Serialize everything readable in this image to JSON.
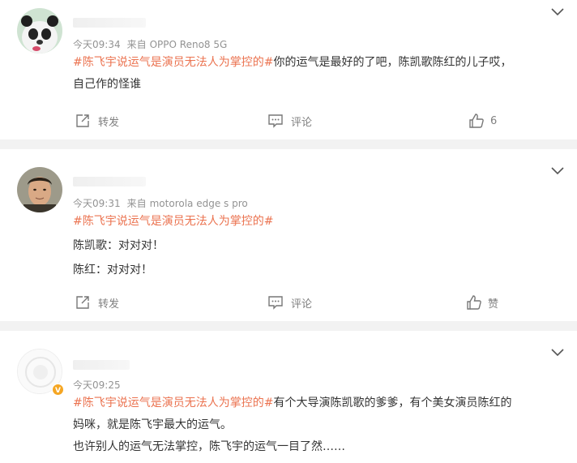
{
  "actions": {
    "repost": "转发",
    "comment": "评论"
  },
  "posts": [
    {
      "time": "今天09:34",
      "source_prefix": "来自",
      "source": "OPPO Reno8 5G",
      "hashtag": "#陈飞宇说运气是演员无法人为掌控的#",
      "text_after_tag": "你的运气是最好的了吧，陈凯歌陈红的儿子哎，",
      "line2": "自己作的怪谁",
      "like_label": "6"
    },
    {
      "time": "今天09:31",
      "source_prefix": "来自",
      "source": "motorola edge s pro",
      "hashtag": "#陈飞宇说运气是演员无法人为掌控的#",
      "line2": "陈凯歌：对对对！",
      "line3": "陈红：对对对！",
      "like_label": "赞"
    },
    {
      "time": "今天09:25",
      "hashtag": "#陈飞宇说运气是演员无法人为掌控的#",
      "text_after_tag": "有个大导演陈凯歌的爹爹，有个美女演员陈红的",
      "line2": "妈咪，就是陈飞宇最大的运气。",
      "line3": "也许别人的运气无法掌控，陈飞宇的运气一目了然……"
    }
  ],
  "colors": {
    "hashtag": "#eb7350",
    "meta": "#939393",
    "separator": "#f2f2f2",
    "verified_badge": "#f5a623"
  },
  "icons": [
    "chevron-down-icon",
    "repost-icon",
    "comment-icon",
    "thumbs-up-icon",
    "verified-badge-icon"
  ]
}
